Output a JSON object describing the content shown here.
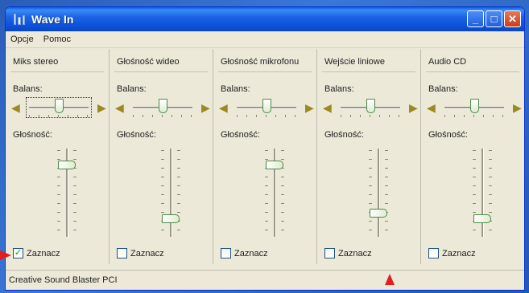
{
  "window": {
    "title": "Wave In",
    "icon": "mixer-app-icon"
  },
  "menu": [
    "Opcje",
    "Pomoc"
  ],
  "labels": {
    "balance": "Balans:",
    "volume": "Głośność:",
    "mute": "Zaznacz"
  },
  "channels": [
    {
      "name": "Miks stereo",
      "balance": 0.5,
      "volume": 0.85,
      "checked": true,
      "focused": true
    },
    {
      "name": "Głośność wideo",
      "balance": 0.5,
      "volume": 0.18,
      "checked": false,
      "focused": false
    },
    {
      "name": "Głośność mikrofonu",
      "balance": 0.5,
      "volume": 0.85,
      "checked": false,
      "focused": false
    },
    {
      "name": "Wejście liniowe",
      "balance": 0.5,
      "volume": 0.25,
      "checked": false,
      "focused": false
    },
    {
      "name": "Audio CD",
      "balance": 0.5,
      "volume": 0.18,
      "checked": false,
      "focused": false
    }
  ],
  "status": "Creative Sound Blaster PCI",
  "colors": {
    "titlebar": "#0b50d8",
    "window": "#ece9d8",
    "annotation_arrow": "#e02020"
  }
}
